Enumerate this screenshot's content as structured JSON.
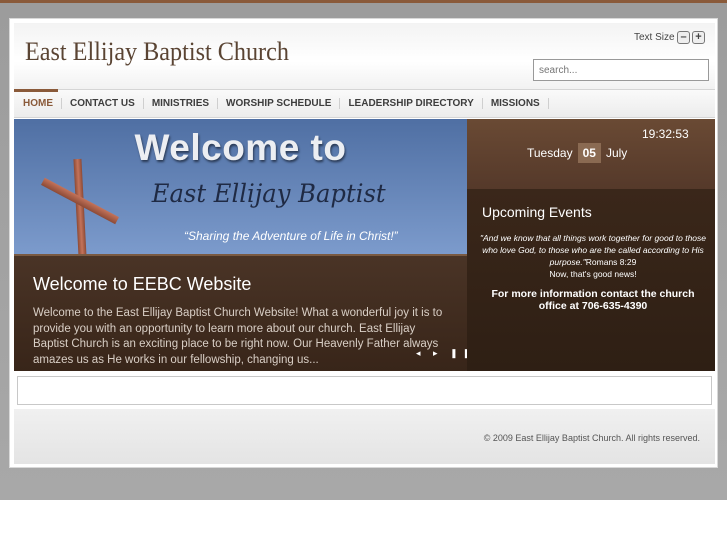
{
  "header": {
    "site_title": "East Ellijay Baptist Church",
    "text_size_label": "Text Size",
    "text_size_decrease": "–",
    "text_size_increase": "+"
  },
  "search": {
    "placeholder": "search..."
  },
  "nav": {
    "items": [
      {
        "label": "HOME"
      },
      {
        "label": "CONTACT US"
      },
      {
        "label": "MINISTRIES"
      },
      {
        "label": "WORSHIP SCHEDULE"
      },
      {
        "label": "LEADERSHIP DIRECTORY"
      },
      {
        "label": "MISSIONS"
      }
    ]
  },
  "banner": {
    "welcome": "Welcome to",
    "church": "East Ellijay Baptist",
    "tagline": "“Sharing the Adventure of Life in Christ!”"
  },
  "feature": {
    "heading": "Welcome to EEBC Website",
    "text": "Welcome to the East Ellijay Baptist Church Website! What a wonderful joy it is to provide you with an opportunity to learn more about our church. East Ellijay Baptist Church is an exciting place to be right now.  Our Heavenly Father always amazes us as He works in our fellowship, changing us...",
    "prev": "◂",
    "next": "▸",
    "pause": "❚❚"
  },
  "sidebar": {
    "clock": "19:32:53",
    "day_name": "Tuesday",
    "day_num": "05",
    "month": "July",
    "events_title": "Upcoming Events",
    "quote": "\"And we know that all things work together for good to those who love God, to those who are the called according to His purpose.\"",
    "quote_ref": "Romans 8:29",
    "news": "Now, that's good news!",
    "contact": "For more information contact the church office at 706-635-4390"
  },
  "footer": {
    "copyright": "© 2009 East Ellijay Baptist Church. All rights reserved."
  },
  "colors": {
    "accent": "#8a5a3a",
    "panel_dark": "#3f2a1c",
    "banner_blue": "#4f6fa3"
  }
}
